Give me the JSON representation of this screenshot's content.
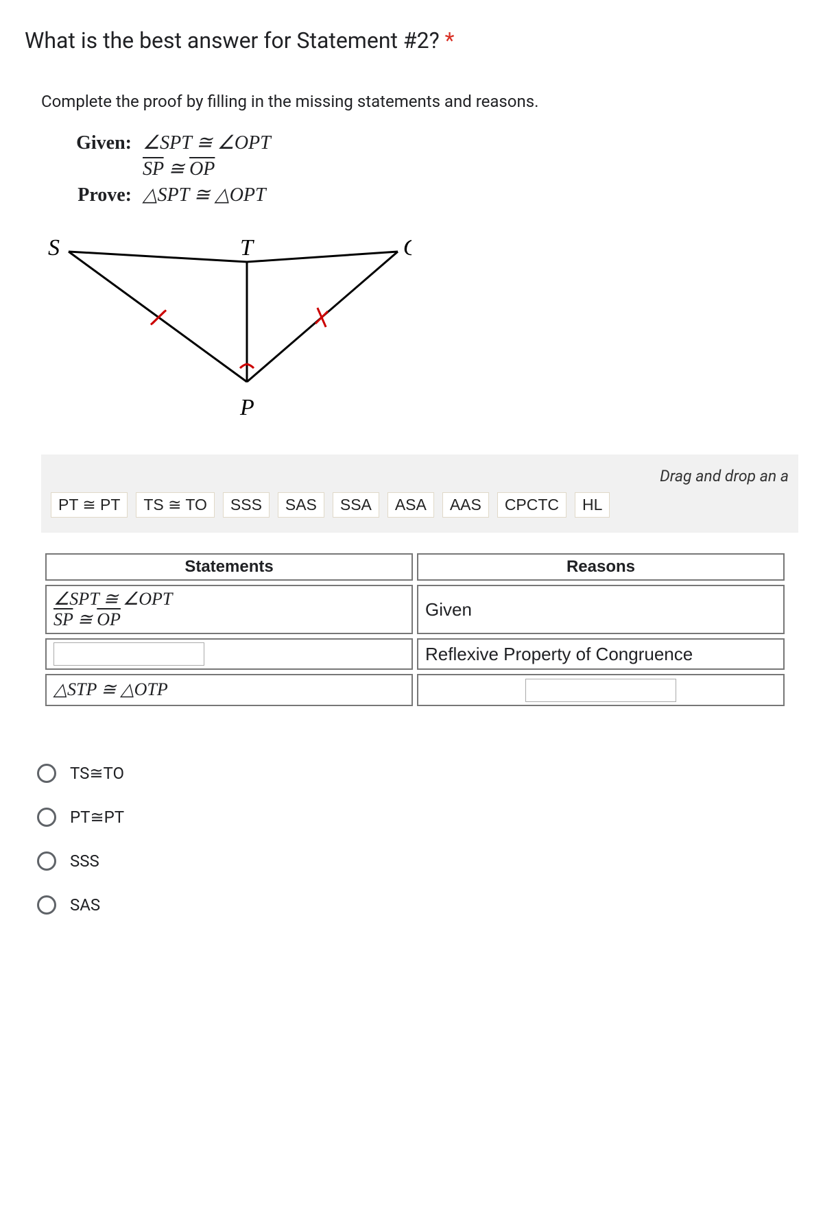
{
  "question": {
    "title": "What is the best answer for Statement #2?",
    "required_mark": "*",
    "instruction": "Complete the proof by filling in the missing statements and reasons."
  },
  "given_prove": {
    "given_label": "Given:",
    "given_line1": "∠SPT ≅ ∠OPT",
    "given_line2_a": "SP",
    "given_line2_mid": " ≅ ",
    "given_line2_b": "OP",
    "prove_label": "Prove:",
    "prove_line": "△SPT ≅ △OPT"
  },
  "diagram": {
    "labels": {
      "S": "S",
      "T": "T",
      "O": "O",
      "P": "P"
    }
  },
  "bank": {
    "hint": "Drag and drop an a",
    "tokens": [
      "PT ≅ PT",
      "TS ≅ TO",
      "SSS",
      "SAS",
      "SSA",
      "ASA",
      "AAS",
      "CPCTC",
      "HL"
    ]
  },
  "table": {
    "headers": {
      "statements": "Statements",
      "reasons": "Reasons"
    },
    "rows": [
      {
        "statement_line1": "∠SPT ≅ ∠OPT",
        "statement_line2_a": "SP",
        "statement_line2_mid": " ≅ ",
        "statement_line2_b": "OP",
        "reason": "Given"
      },
      {
        "statement_blank": true,
        "reason": "Reflexive Property of Congruence"
      },
      {
        "statement_text": "△STP ≅ △OTP",
        "reason_blank": true
      }
    ]
  },
  "options": [
    "TS≅TO",
    "PT≅PT",
    "SSS",
    "SAS"
  ]
}
